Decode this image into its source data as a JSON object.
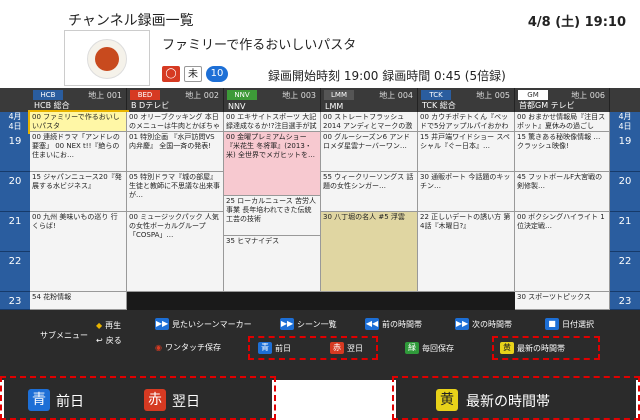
{
  "header": {
    "title": "チャンネル録画一覧",
    "datetime": "4/8 (土) 19:10"
  },
  "program": {
    "title": "ファミリーで作るおいしいパスタ",
    "badges": {
      "cc": "◯",
      "mi": "未",
      "ten": "10"
    },
    "rec_info": "録画開始時刻 19:00  録画時間  0:45 (5倍録)"
  },
  "grid": {
    "date": [
      "4月",
      "4日",
      "(火)"
    ],
    "channels": [
      {
        "logo": "HCB",
        "name": "HCB 総合",
        "num": "地上 001"
      },
      {
        "logo": "BED",
        "name": "B Dテレビ",
        "num": "地上 002"
      },
      {
        "logo": "NNV",
        "name": "NNV",
        "num": "地上 003"
      },
      {
        "logo": "LMM",
        "name": "LMM",
        "num": "地上 004"
      },
      {
        "logo": "TCK",
        "name": "TCK 総合",
        "num": "地上 005"
      },
      {
        "logo": "GM",
        "name": "首都GM テレビ",
        "num": "地上 006"
      }
    ],
    "hours": [
      "19",
      "20",
      "21",
      "22",
      "23"
    ],
    "right_date": [
      "4月",
      "4日",
      "(火)"
    ],
    "cells": [
      [
        "00 ファミリーで作るおいしいパスタ",
        "00 オリーブクッキング 本日のメニューは牛肉とかぼちゃの…",
        "00 エキサイトスポーツ 大記録達成なるか!?注目選手が試合に出場!",
        "00 ストレートフラッシュ 2014 アンディとマークの激しく楽しき…",
        "00 カウチポテトくん『ベッドで5分アップルパイおかわり』 今日は…",
        "00 おまかせ情報局『注目スポット』夏休みの過ごし方…"
      ],
      [
        "00 連続ドラマ「アンドレの要塞」 00 NEX t!!『絶らの住まいにお…",
        "01 特別企画 『水戸訪問VS内弁慶』 全国一斉の発表!",
        "00 金曜プレミアムショー『米花生 冬将軍』(2013・米) 全世界でメガヒットを…",
        "00 グルーシーズン6 アンドロメダ星雲ナーバーワン…",
        "15 井戸端ワイドショー スペシャル『ぐー日本』…",
        "15 驚きある秘映像情報 …クラッシュ映像!"
      ],
      [
        "15 ジャパンニュース20『発展する水ビジネス』",
        "05 特別ドラマ『城の部屋』 生徒と教師に不思議な出来事が…",
        "25 ローカルニュース 苦労人事業 長年培われてきた伝統工芸の技術",
        "55 ウィークリーソングス 話題の女性シンガー…",
        "30 通販ポート 今話題のキッチン…",
        "45 フットボールF大宮戦の剣修製…"
      ],
      [
        "00 九州 美味いもの巡り 行くらば!",
        "00 ミュージックパック 人気の女性ボーカルグループ「COSPA」…",
        "35 ヒマナイデス",
        "30 八丁堀の名人 #5 浮雲",
        "22 正しいデートの誘い方 第4話『木曜日?』",
        "00 ボクシングハイライト 1位決定戦…"
      ],
      [
        "54 花粉情報",
        "",
        "",
        "",
        "",
        "30 スポーツトピックス"
      ]
    ]
  },
  "footer": {
    "sub_menu": "サブメニュー",
    "play": "再生",
    "back": "戻る",
    "one_touch": "ワンタッチ保存",
    "scene": "見たいシーンマーカー",
    "scene_list": "シーン一覧",
    "prev_slot": "前の時間帯",
    "next_slot": "次の時間帯",
    "date_select": "日付選択",
    "blue_key": "青",
    "blue_label": "前日",
    "red_key": "赤",
    "red_label": "翌日",
    "green_key": "緑",
    "green_label": "毎回保存",
    "yellow_key": "黄",
    "yellow_label": "最新の時間帯"
  },
  "zoom": {
    "blue_key": "青",
    "blue_label": "前日",
    "red_key": "赤",
    "red_label": "翌日",
    "yellow_key": "黄",
    "yellow_label": "最新の時間帯"
  },
  "colors": {
    "blue": "#1d6fd6",
    "red": "#d63a22",
    "green": "#2f9a3a",
    "yellow": "#e8d21a",
    "highlight": "#fff7a6",
    "dash": "#e00000"
  }
}
